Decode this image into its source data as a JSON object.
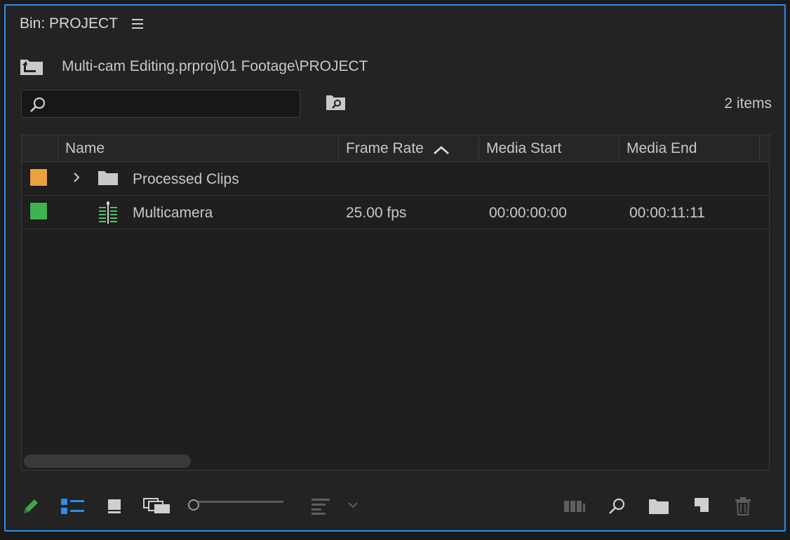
{
  "panel": {
    "title": "Bin: PROJECT"
  },
  "path": {
    "text": "Multi-cam Editing.prproj\\01 Footage\\PROJECT"
  },
  "search": {
    "value": "",
    "placeholder": ""
  },
  "item_count": "2 items",
  "columns": [
    "Name",
    "Frame Rate",
    "Media Start",
    "Media End"
  ],
  "sorted_column": "Frame Rate",
  "sort_direction": "ascending",
  "rows": [
    {
      "label_color": "#e8a33d",
      "icon": "folder-icon",
      "expandable": true,
      "name": "Processed Clips",
      "frame_rate": "",
      "media_start": "",
      "media_end": ""
    },
    {
      "label_color": "#3fb34f",
      "icon": "multicamera-sequence-icon",
      "expandable": false,
      "name": "Multicamera",
      "frame_rate": "25.00 fps",
      "media_start": "00:00:00:00",
      "media_end": "00:00:11:11"
    }
  ],
  "colors": {
    "accent": "#2d8ceb",
    "active_tool": "#3fa64c"
  },
  "toolbar": {
    "left": [
      "pencil-icon",
      "list-view-icon",
      "icon-view-icon",
      "freeform-view-icon",
      "zoom-slider",
      "sort-icons-icon",
      "chevron-down-icon"
    ],
    "right": [
      "automate-to-sequence-icon",
      "find-icon",
      "new-bin-icon",
      "new-item-icon",
      "trash-icon"
    ]
  }
}
